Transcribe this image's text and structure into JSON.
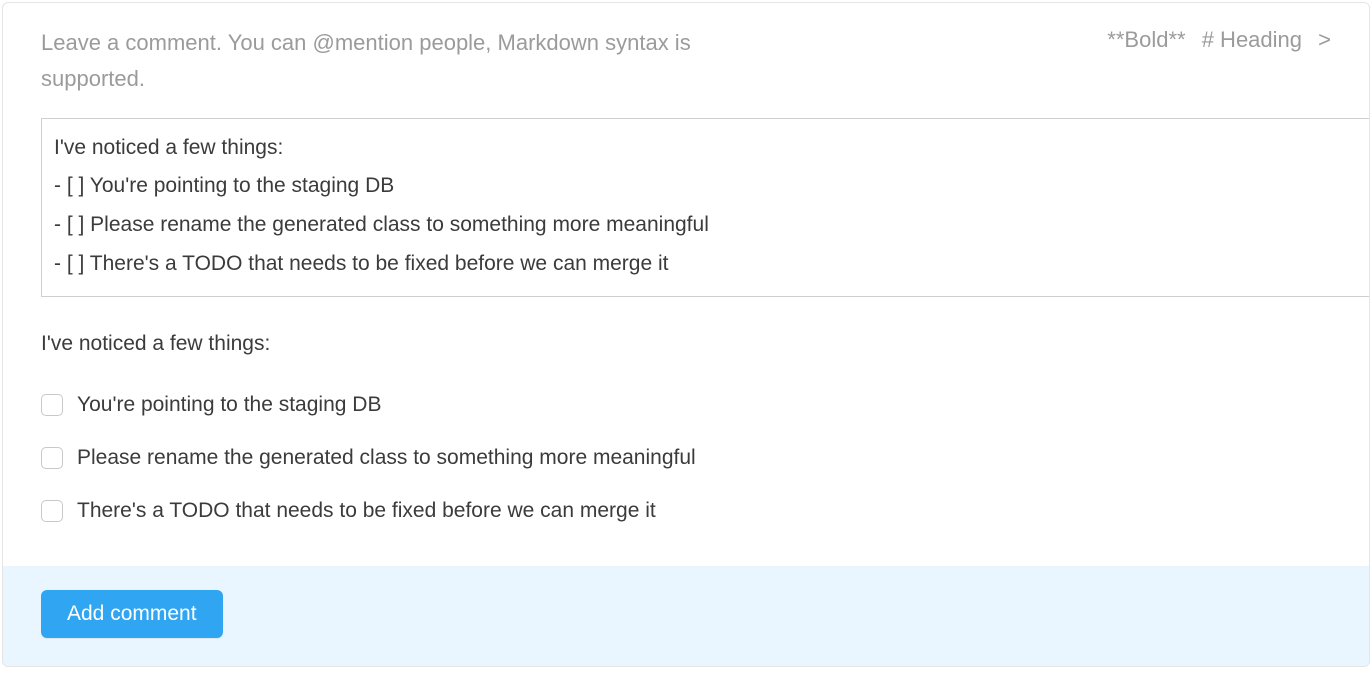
{
  "header": {
    "placeholder": "Leave a comment. You can @mention people, Markdown syntax is supported.",
    "hints": [
      "**Bold**",
      "# Heading",
      ">"
    ]
  },
  "editor": {
    "lines": [
      "I've noticed a few things:",
      "- [ ] You're pointing to the staging DB",
      "- [ ] Please rename the generated class to something more meaningful",
      "- [ ] There's a TODO that needs to be fixed before we can merge it"
    ]
  },
  "preview": {
    "intro": "I've noticed a few things:",
    "tasks": [
      {
        "checked": false,
        "label": "You're pointing to the staging DB"
      },
      {
        "checked": false,
        "label": "Please rename the generated class to something more meaningful"
      },
      {
        "checked": false,
        "label": "There's a TODO that needs to be fixed before we can merge it"
      }
    ]
  },
  "footer": {
    "add_label": "Add comment"
  }
}
